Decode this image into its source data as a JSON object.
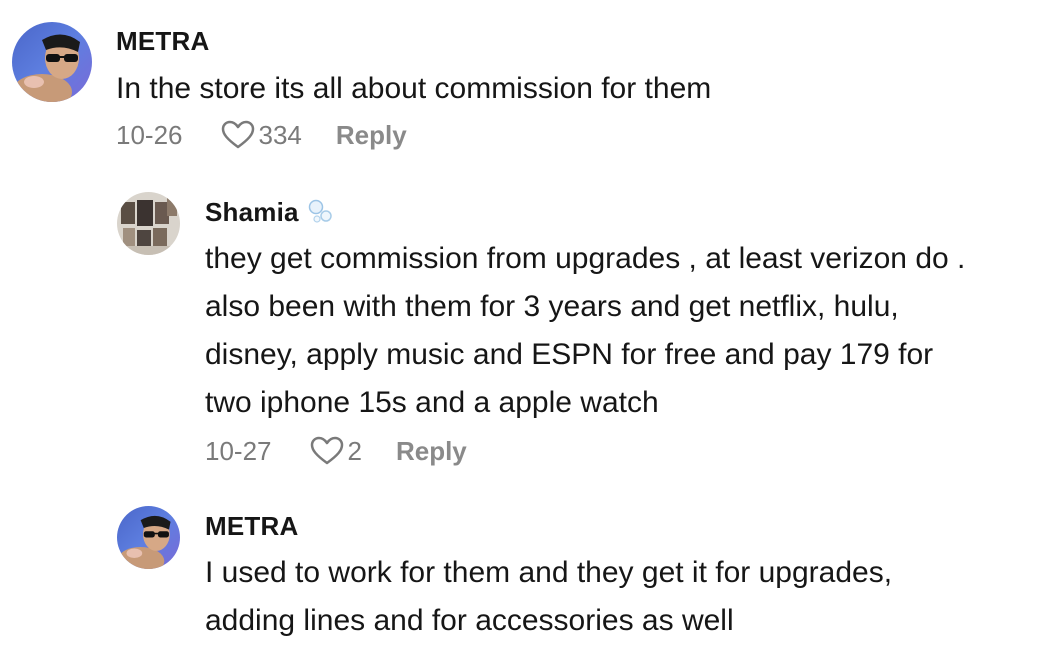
{
  "comments": [
    {
      "username": "METRA",
      "text": "In the store its all about commission for them",
      "date": "10-26",
      "likes": "334",
      "reply_label": "Reply",
      "avatar_icon": "profile-photo"
    },
    {
      "username": "Shamia",
      "username_badge_icon": "bubbles-icon",
      "text_lines": [
        "they get commission from upgrades , at least verizon do .",
        "also been with them for 3 years and get netflix, hulu,",
        "disney, apply music and ESPN for free and pay 179 for",
        "two iphone 15s and a apple watch"
      ],
      "date": "10-27",
      "likes": "2",
      "reply_label": "Reply",
      "avatar_icon": "profile-photo"
    },
    {
      "username": "METRA",
      "text_lines": [
        "I used to work for them and they get it for upgrades,",
        "adding lines and for accessories as well"
      ],
      "avatar_icon": "profile-photo"
    }
  ],
  "colors": {
    "text": "#161616",
    "meta": "#7a7a7a",
    "background": "#ffffff"
  }
}
